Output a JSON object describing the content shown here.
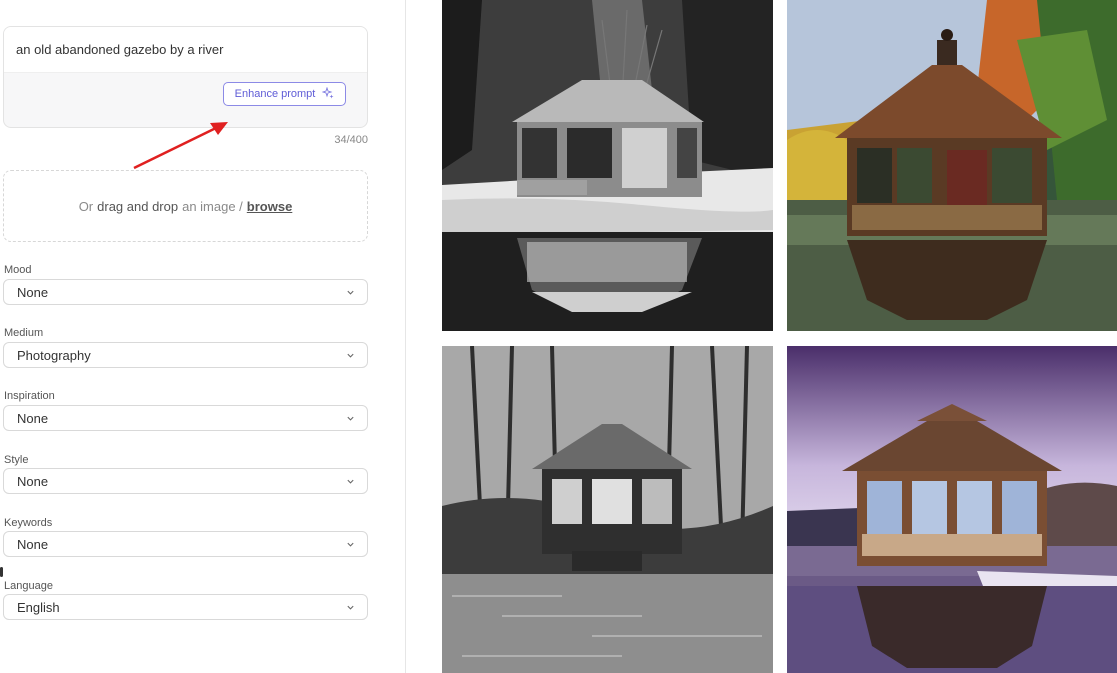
{
  "prompt": {
    "text": "an old abandoned gazebo by a river",
    "enhance_label": "Enhance prompt",
    "char_count": "34/400"
  },
  "drop_zone": {
    "prefix": "Or",
    "drag_text": "drag and drop",
    "middle": "an image /",
    "browse": "browse"
  },
  "fields": [
    {
      "label": "Mood",
      "value": "None"
    },
    {
      "label": "Medium",
      "value": "Photography"
    },
    {
      "label": "Inspiration",
      "value": "None"
    },
    {
      "label": "Style",
      "value": "None"
    },
    {
      "label": "Keywords",
      "value": "None"
    },
    {
      "label": "Language",
      "value": "English"
    }
  ],
  "images": [
    {
      "name": "gazebo-image-1",
      "style": "black-and-white snowy river"
    },
    {
      "name": "gazebo-image-2",
      "style": "autumn color lake"
    },
    {
      "name": "gazebo-image-3",
      "style": "black-and-white forest river"
    },
    {
      "name": "gazebo-image-4",
      "style": "purple sky winter lake"
    }
  ],
  "colors": {
    "accent": "#5f5cd6",
    "annotation_arrow": "#e02020"
  }
}
